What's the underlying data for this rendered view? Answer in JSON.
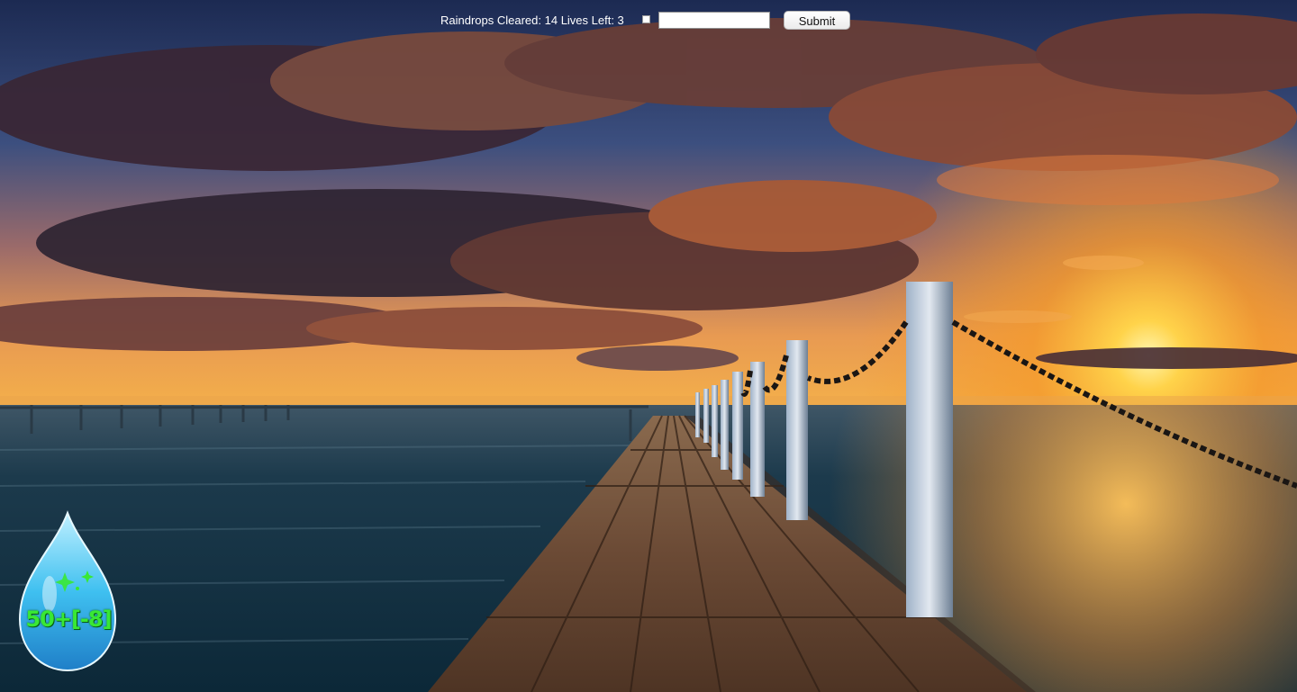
{
  "hud": {
    "status_text": "Raindrops Cleared: 14 Lives Left: 3",
    "answer_value": "",
    "submit_label": "Submit"
  },
  "raindrop": {
    "equation": "50+[-8]",
    "sparkle_color": "#39e834"
  },
  "colors": {
    "sky_top": "#1c2a52",
    "sunset": "#ff9a1f",
    "water": "#153447",
    "boardwalk": "#6b4a35"
  }
}
